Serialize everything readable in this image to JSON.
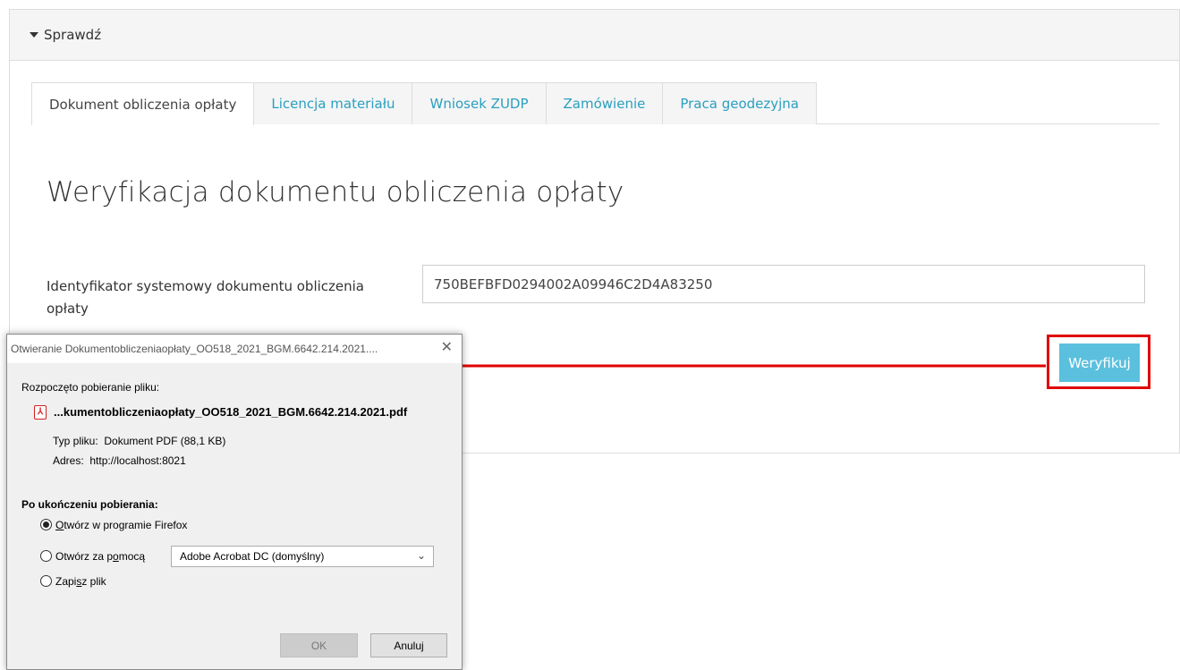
{
  "panel": {
    "header_label": "Sprawdź",
    "tabs": [
      {
        "label": "Dokument obliczenia opłaty",
        "active": true
      },
      {
        "label": "Licencja materiału",
        "active": false
      },
      {
        "label": "Wniosek ZUDP",
        "active": false
      },
      {
        "label": "Zamówienie",
        "active": false
      },
      {
        "label": "Praca geodezyjna",
        "active": false
      }
    ],
    "title": "Weryfikacja dokumentu obliczenia opłaty",
    "field_label": "Identyfikator systemowy dokumentu obliczenia opłaty",
    "field_value": "750BEFBFD0294002A09946C2D4A83250",
    "verify_button": "Weryfikuj"
  },
  "dialog": {
    "title": "Otwieranie Dokumentobliczeniaopłaty_OO518_2021_BGM.6642.214.2021....",
    "close_glyph": "✕",
    "intro": "Rozpoczęto pobieranie pliku:",
    "file_icon": "pdf-icon",
    "file_name": "...kumentobliczeniaopłaty_OO518_2021_BGM.6642.214.2021.pdf",
    "type_label": "Typ pliku:",
    "type_value": "Dokument PDF (88,1 KB)",
    "address_label": "Adres:",
    "address_value": "http://localhost:8021",
    "after_label": "Po ukończeniu pobierania:",
    "options": {
      "open_firefox": {
        "pre": "",
        "key": "O",
        "post": "twórz w programie Firefox",
        "checked": true
      },
      "open_with": {
        "pre": "Otwórz za p",
        "key": "o",
        "post": "mocą",
        "checked": false
      },
      "save": {
        "pre": "Zapi",
        "key": "s",
        "post": "z plik",
        "checked": false
      }
    },
    "app_select_value": "Adobe Acrobat DC (domyślny)",
    "ok_button": "OK",
    "cancel_button": "Anuluj"
  },
  "colors": {
    "accent_blue": "#5bc0de",
    "tab_link": "#2a9fbf",
    "highlight_red": "#e00000"
  }
}
